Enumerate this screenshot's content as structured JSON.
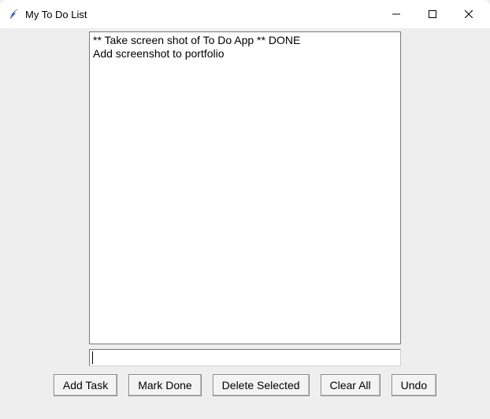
{
  "window": {
    "title": "My To Do List"
  },
  "list": {
    "items": [
      "** Take screen shot of To Do App ** DONE",
      "Add screenshot to portfolio"
    ]
  },
  "entry": {
    "value": ""
  },
  "buttons": {
    "add": "Add Task",
    "done": "Mark Done",
    "delete": "Delete Selected",
    "clear": "Clear All",
    "undo": "Undo"
  }
}
